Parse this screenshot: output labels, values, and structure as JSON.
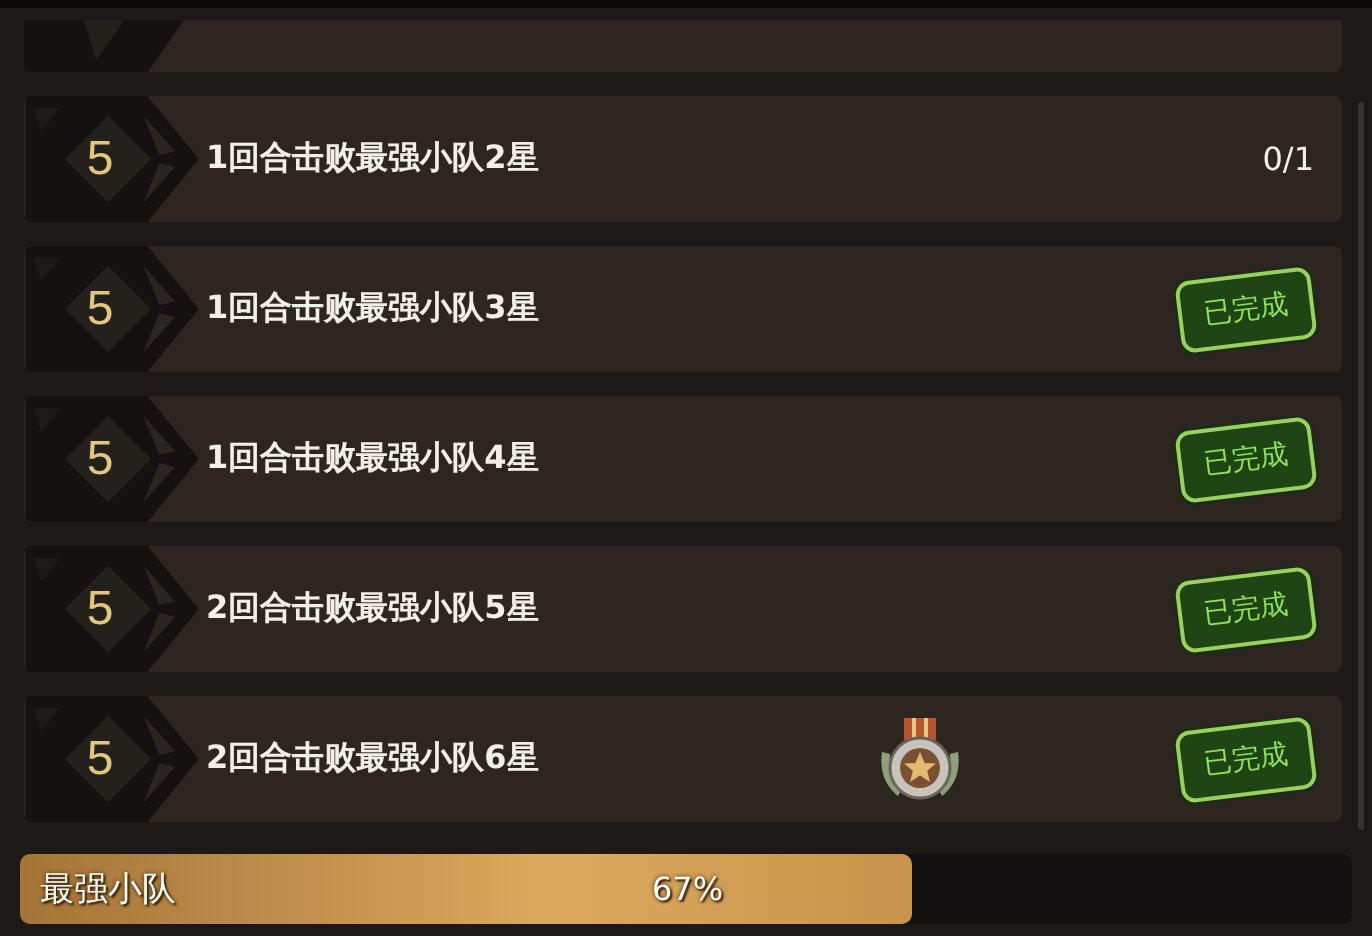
{
  "tasks": [
    {
      "rank": "5",
      "title": "1回合击败最强小队2星",
      "status": {
        "kind": "count",
        "text": "0/1"
      },
      "medal": false
    },
    {
      "rank": "5",
      "title": "1回合击败最强小队3星",
      "status": {
        "kind": "stamp",
        "text": "已完成"
      },
      "medal": false
    },
    {
      "rank": "5",
      "title": "1回合击败最强小队4星",
      "status": {
        "kind": "stamp",
        "text": "已完成"
      },
      "medal": false
    },
    {
      "rank": "5",
      "title": "2回合击败最强小队5星",
      "status": {
        "kind": "stamp",
        "text": "已完成"
      },
      "medal": false
    },
    {
      "rank": "5",
      "title": "2回合击败最强小队6星",
      "status": {
        "kind": "stamp",
        "text": "已完成"
      },
      "medal": true
    }
  ],
  "progress": {
    "label": "最强小队",
    "text": "67%",
    "level": 0.67
  }
}
